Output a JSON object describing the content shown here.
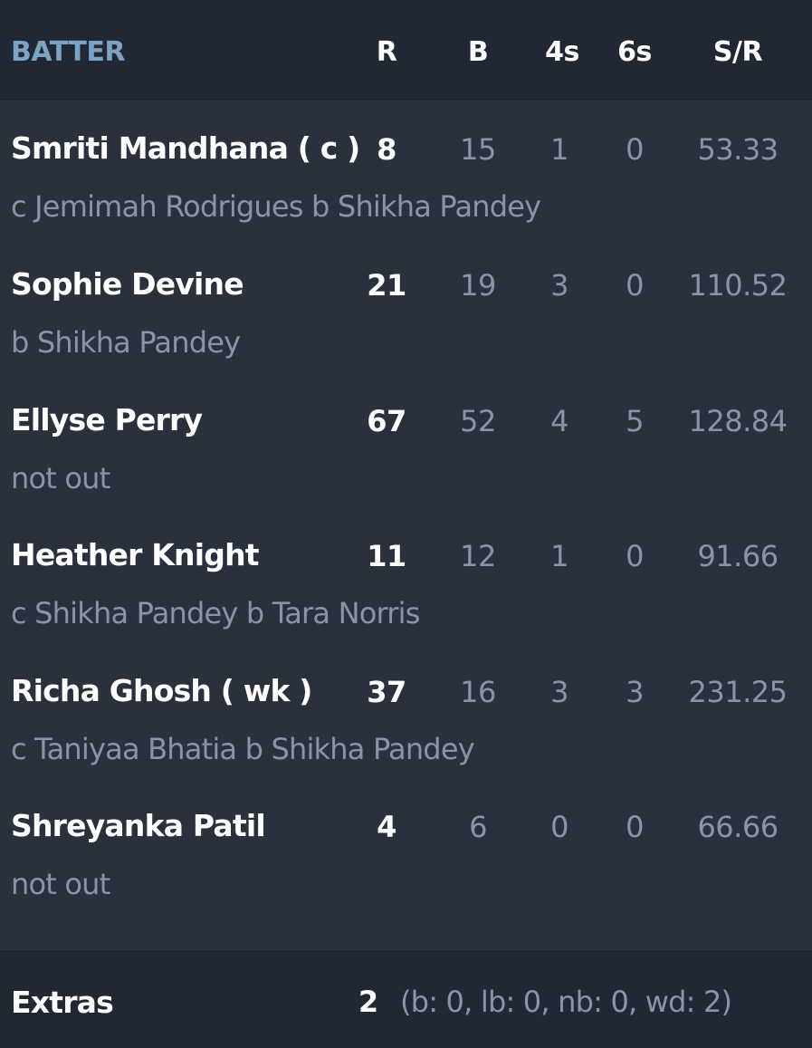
{
  "header": {
    "batter": "BATTER",
    "runs": "R",
    "balls": "B",
    "fours": "4s",
    "sixes": "6s",
    "strike_rate": "S/R"
  },
  "batters": [
    {
      "name": "Smriti Mandhana ( c )",
      "dismissal": "c Jemimah Rodrigues b Shikha Pandey",
      "runs": "8",
      "balls": "15",
      "fours": "1",
      "sixes": "0",
      "strike_rate": "53.33"
    },
    {
      "name": "Sophie Devine",
      "dismissal": "b Shikha Pandey",
      "runs": "21",
      "balls": "19",
      "fours": "3",
      "sixes": "0",
      "strike_rate": "110.52"
    },
    {
      "name": "Ellyse Perry",
      "dismissal": "not out",
      "runs": "67",
      "balls": "52",
      "fours": "4",
      "sixes": "5",
      "strike_rate": "128.84"
    },
    {
      "name": "Heather Knight",
      "dismissal": "c Shikha Pandey b Tara Norris",
      "runs": "11",
      "balls": "12",
      "fours": "1",
      "sixes": "0",
      "strike_rate": "91.66"
    },
    {
      "name": "Richa Ghosh ( wk )",
      "dismissal": "c Taniyaa Bhatia b Shikha Pandey",
      "runs": "37",
      "balls": "16",
      "fours": "3",
      "sixes": "3",
      "strike_rate": "231.25"
    },
    {
      "name": "Shreyanka Patil",
      "dismissal": "not out",
      "runs": "4",
      "balls": "6",
      "fours": "0",
      "sixes": "0",
      "strike_rate": "66.66"
    }
  ],
  "extras": {
    "label": "Extras",
    "total": "2",
    "breakdown": "(b: 0, lb: 0, nb: 0, wd: 2)"
  }
}
